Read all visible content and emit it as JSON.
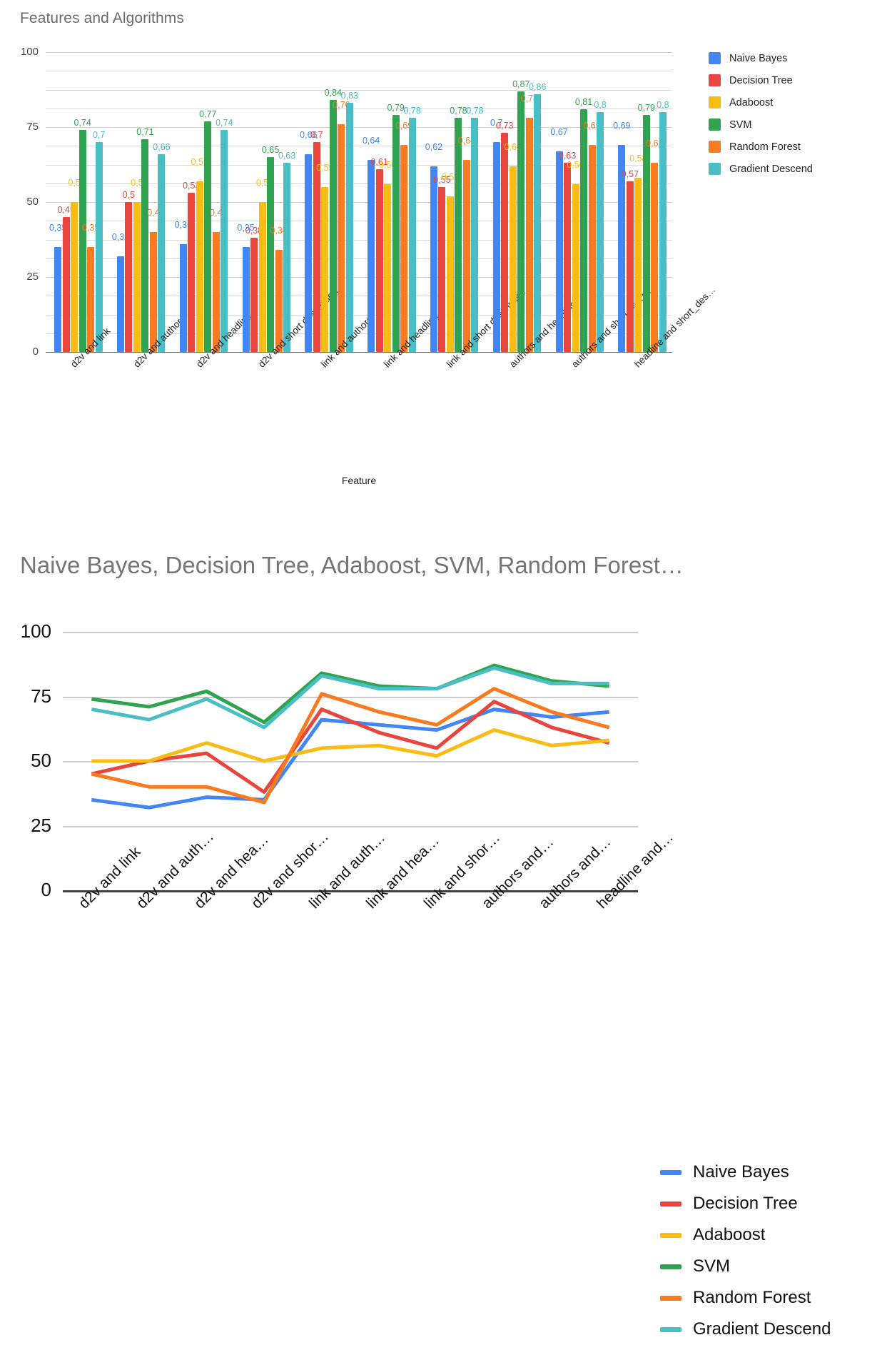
{
  "chart_data": [
    {
      "type": "bar",
      "title": "Features and Algorithms",
      "xlabel": "Feature",
      "ylabel": "",
      "ylim": [
        0,
        100
      ],
      "grid": true,
      "legend_position": "right",
      "ytick_labels": [
        "100",
        "75",
        "50",
        "25",
        "0"
      ],
      "ytick_values": [
        100,
        75,
        50,
        25,
        0
      ],
      "categories": [
        "d2v and link",
        "d2v and authors",
        "d2v and headline",
        "d2v and short description",
        "link and authors",
        "link and headline",
        "link and short description",
        "authors and headline",
        "authors and short descr…",
        "headline and short_des…"
      ],
      "series": [
        {
          "name": "Naive Bayes",
          "color": "#4285f4",
          "values": [
            35,
            32,
            36,
            35,
            66,
            64,
            62,
            70,
            67,
            69
          ],
          "labels": [
            "0,35",
            "0,32",
            "0,36",
            "0,35",
            "0,66",
            "0,64",
            "0,62",
            "0,7",
            "0,67",
            "0,69"
          ]
        },
        {
          "name": "Decision Tree",
          "color": "#e8453c",
          "values": [
            45,
            50,
            53,
            38,
            70,
            61,
            55,
            73,
            63,
            57
          ],
          "labels": [
            "0,45",
            "0,5",
            "0,53",
            "0,38",
            "0,7",
            "0,61",
            "0,55",
            "0,73",
            "0,63",
            "0,57"
          ]
        },
        {
          "name": "Adaboost",
          "color": "#f9bc15",
          "values": [
            50,
            50,
            57,
            50,
            55,
            56,
            52,
            62,
            56,
            58
          ],
          "labels": [
            "0,5",
            "0,5",
            "0,57",
            "0,5",
            "0,55",
            "0,56",
            "0,52",
            "0,62",
            "0,56",
            "0,58"
          ]
        },
        {
          "name": "SVM",
          "color": "#30a350",
          "values": [
            74,
            71,
            77,
            65,
            84,
            79,
            78,
            87,
            81,
            79
          ],
          "labels": [
            "0,74",
            "0,71",
            "0,77",
            "0,65",
            "0,84",
            "0,79",
            "0,78",
            "0,87",
            "0,81",
            "0,79"
          ]
        },
        {
          "name": "Random Forest",
          "color": "#f97a1f",
          "values": [
            35,
            40,
            40,
            34,
            76,
            69,
            64,
            78,
            69,
            63
          ],
          "labels": [
            "0,35",
            "0,4",
            "0,4",
            "0,34",
            "0,76",
            "0,69",
            "0,64",
            "0,78",
            "0,69",
            "0,63"
          ]
        },
        {
          "name": "Gradient Descend",
          "color": "#49bec4",
          "values": [
            70,
            66,
            74,
            63,
            83,
            78,
            78,
            86,
            80,
            80
          ],
          "labels": [
            "0,7",
            "0,66",
            "0,74",
            "0,63",
            "0,83",
            "0,78",
            "0,78",
            "0,86",
            "0,8",
            "0,8"
          ]
        }
      ]
    },
    {
      "type": "line",
      "title": "Naive Bayes, Decision Tree, Adaboost, SVM, Random Forest…",
      "xlabel": "",
      "ylabel": "",
      "ylim": [
        0,
        100
      ],
      "grid": true,
      "legend_position": "right",
      "ytick_labels": [
        "100",
        "75",
        "50",
        "25",
        "0"
      ],
      "ytick_values": [
        100,
        75,
        50,
        25,
        0
      ],
      "categories": [
        "d2v and link",
        "d2v and auth…",
        "d2v and hea…",
        "d2v and shor…",
        "link and auth…",
        "link and hea…",
        "link and shor…",
        "authors and…",
        "authors and…",
        "headline and…"
      ],
      "series": [
        {
          "name": "Naive Bayes",
          "color": "#4285f4",
          "values": [
            35,
            32,
            36,
            35,
            66,
            64,
            62,
            70,
            67,
            69
          ]
        },
        {
          "name": "Decision Tree",
          "color": "#e8453c",
          "values": [
            45,
            50,
            53,
            38,
            70,
            61,
            55,
            73,
            63,
            57
          ]
        },
        {
          "name": "Adaboost",
          "color": "#f9bc15",
          "values": [
            50,
            50,
            57,
            50,
            55,
            56,
            52,
            62,
            56,
            58
          ]
        },
        {
          "name": "SVM",
          "color": "#30a350",
          "values": [
            74,
            71,
            77,
            65,
            84,
            79,
            78,
            87,
            81,
            79
          ]
        },
        {
          "name": "Random Forest",
          "color": "#f97a1f",
          "values": [
            45,
            40,
            40,
            34,
            76,
            69,
            64,
            78,
            69,
            63
          ]
        },
        {
          "name": "Gradient Descend",
          "color": "#49bec4",
          "values": [
            70,
            66,
            74,
            63,
            83,
            78,
            78,
            86,
            80,
            80
          ]
        }
      ]
    }
  ]
}
